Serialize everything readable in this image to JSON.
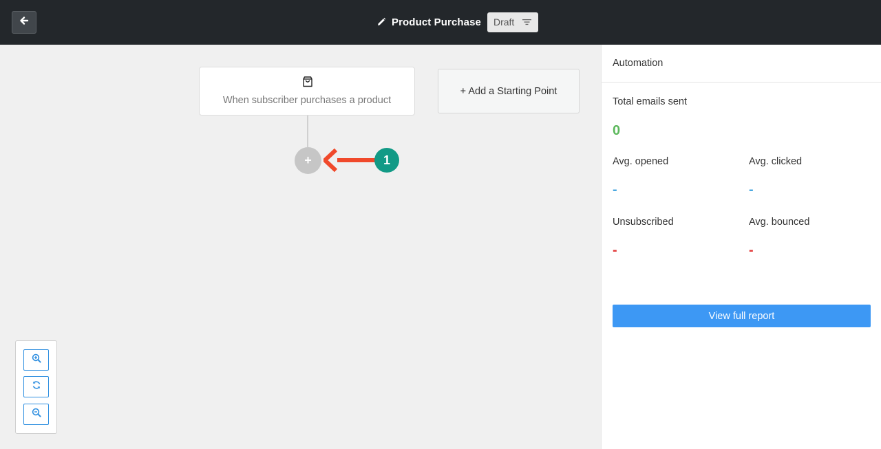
{
  "header": {
    "back_icon": "arrow-left-icon",
    "edit_icon": "pencil-icon",
    "title": "Product Purchase",
    "status": "Draft",
    "status_icon": "filter-lines-icon"
  },
  "canvas": {
    "trigger": {
      "icon": "shopping-bag-icon",
      "label": "When subscriber purchases a product"
    },
    "add_starting_point": "+ Add a Starting Point",
    "add_step_symbol": "+",
    "annotation": {
      "step_number": "1",
      "arrow_color": "#f0492b",
      "badge_color": "#129a86"
    },
    "zoom_controls": [
      "zoom-in-icon",
      "reset-refresh-icon",
      "zoom-out-icon"
    ]
  },
  "panel": {
    "title": "Automation",
    "total_emails_label": "Total emails sent",
    "total_emails_value": "0",
    "avg_opened_label": "Avg. opened",
    "avg_opened_value": "-",
    "avg_clicked_label": "Avg. clicked",
    "avg_clicked_value": "-",
    "unsubscribed_label": "Unsubscribed",
    "unsubscribed_value": "-",
    "avg_bounced_label": "Avg. bounced",
    "avg_bounced_value": "-",
    "report_button": "View full report"
  },
  "colors": {
    "topbar": "#23272b",
    "primary_button": "#3d98f4",
    "success_value": "#5cb85c",
    "info_value": "#4aa8e0",
    "danger_value": "#e23b3b"
  }
}
